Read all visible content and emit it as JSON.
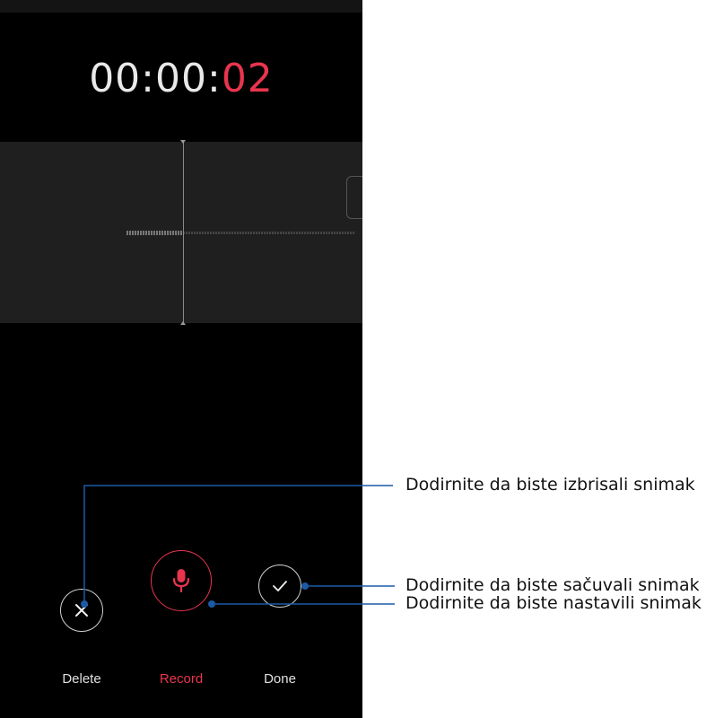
{
  "timer": {
    "prefix": "00:00:",
    "seconds": "02"
  },
  "controls": {
    "delete_label": "Delete",
    "record_label": "Record",
    "done_label": "Done"
  },
  "callouts": {
    "delete": "Dodirnite da biste izbrisali snimak",
    "record": "Dodirnite da biste nastavili snimak",
    "done": "Dodirnite da biste sačuvali snimak"
  },
  "colors": {
    "accent": "#e8354d",
    "callout_line": "#1c5aa6",
    "background": "#000000"
  },
  "icons": {
    "delete": "close-icon",
    "record": "microphone-icon",
    "done": "checkmark-icon"
  }
}
